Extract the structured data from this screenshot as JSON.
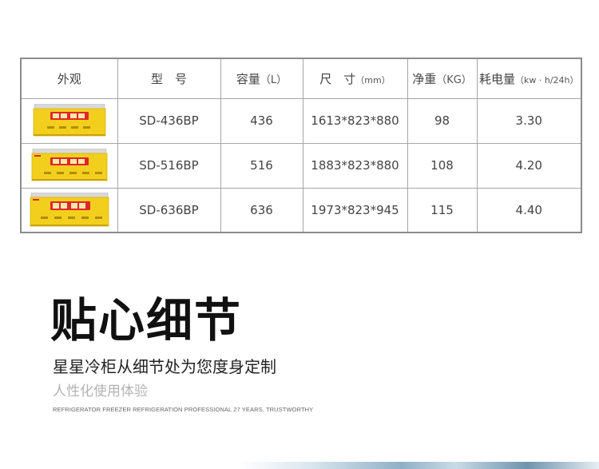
{
  "table": {
    "headers": {
      "appearance": "外观",
      "model": "型　号",
      "capacity": "容量",
      "capacity_unit": "（L）",
      "size": "尺　寸",
      "size_unit": "（mm）",
      "weight": "净重",
      "weight_unit": "（KG）",
      "power": "耗电量",
      "power_unit": "（kw · h/24h）"
    },
    "rows": [
      {
        "model": "SD-436BP",
        "capacity": "436",
        "size": "1613*823*880",
        "weight": "98",
        "power": "3.30"
      },
      {
        "model": "SD-516BP",
        "capacity": "516",
        "size": "1883*823*880",
        "weight": "108",
        "power": "4.20"
      },
      {
        "model": "SD-636BP",
        "capacity": "636",
        "size": "1973*823*945",
        "weight": "115",
        "power": "4.40"
      }
    ],
    "colors": {
      "freezer_body": "#f2cf1d",
      "freezer_panel": "#e0262b",
      "freezer_lid": "#d9d9d9"
    }
  },
  "section": {
    "headline": "贴心细节",
    "subtitle": "星星冷柜从细节处为您度身定制",
    "subtitle2": "人性化使用体验",
    "english": "REFRIGERATOR FREEZER REFRIGERATION PROFESSIONAL 27 YEARS, TRUSTWORTHY"
  }
}
